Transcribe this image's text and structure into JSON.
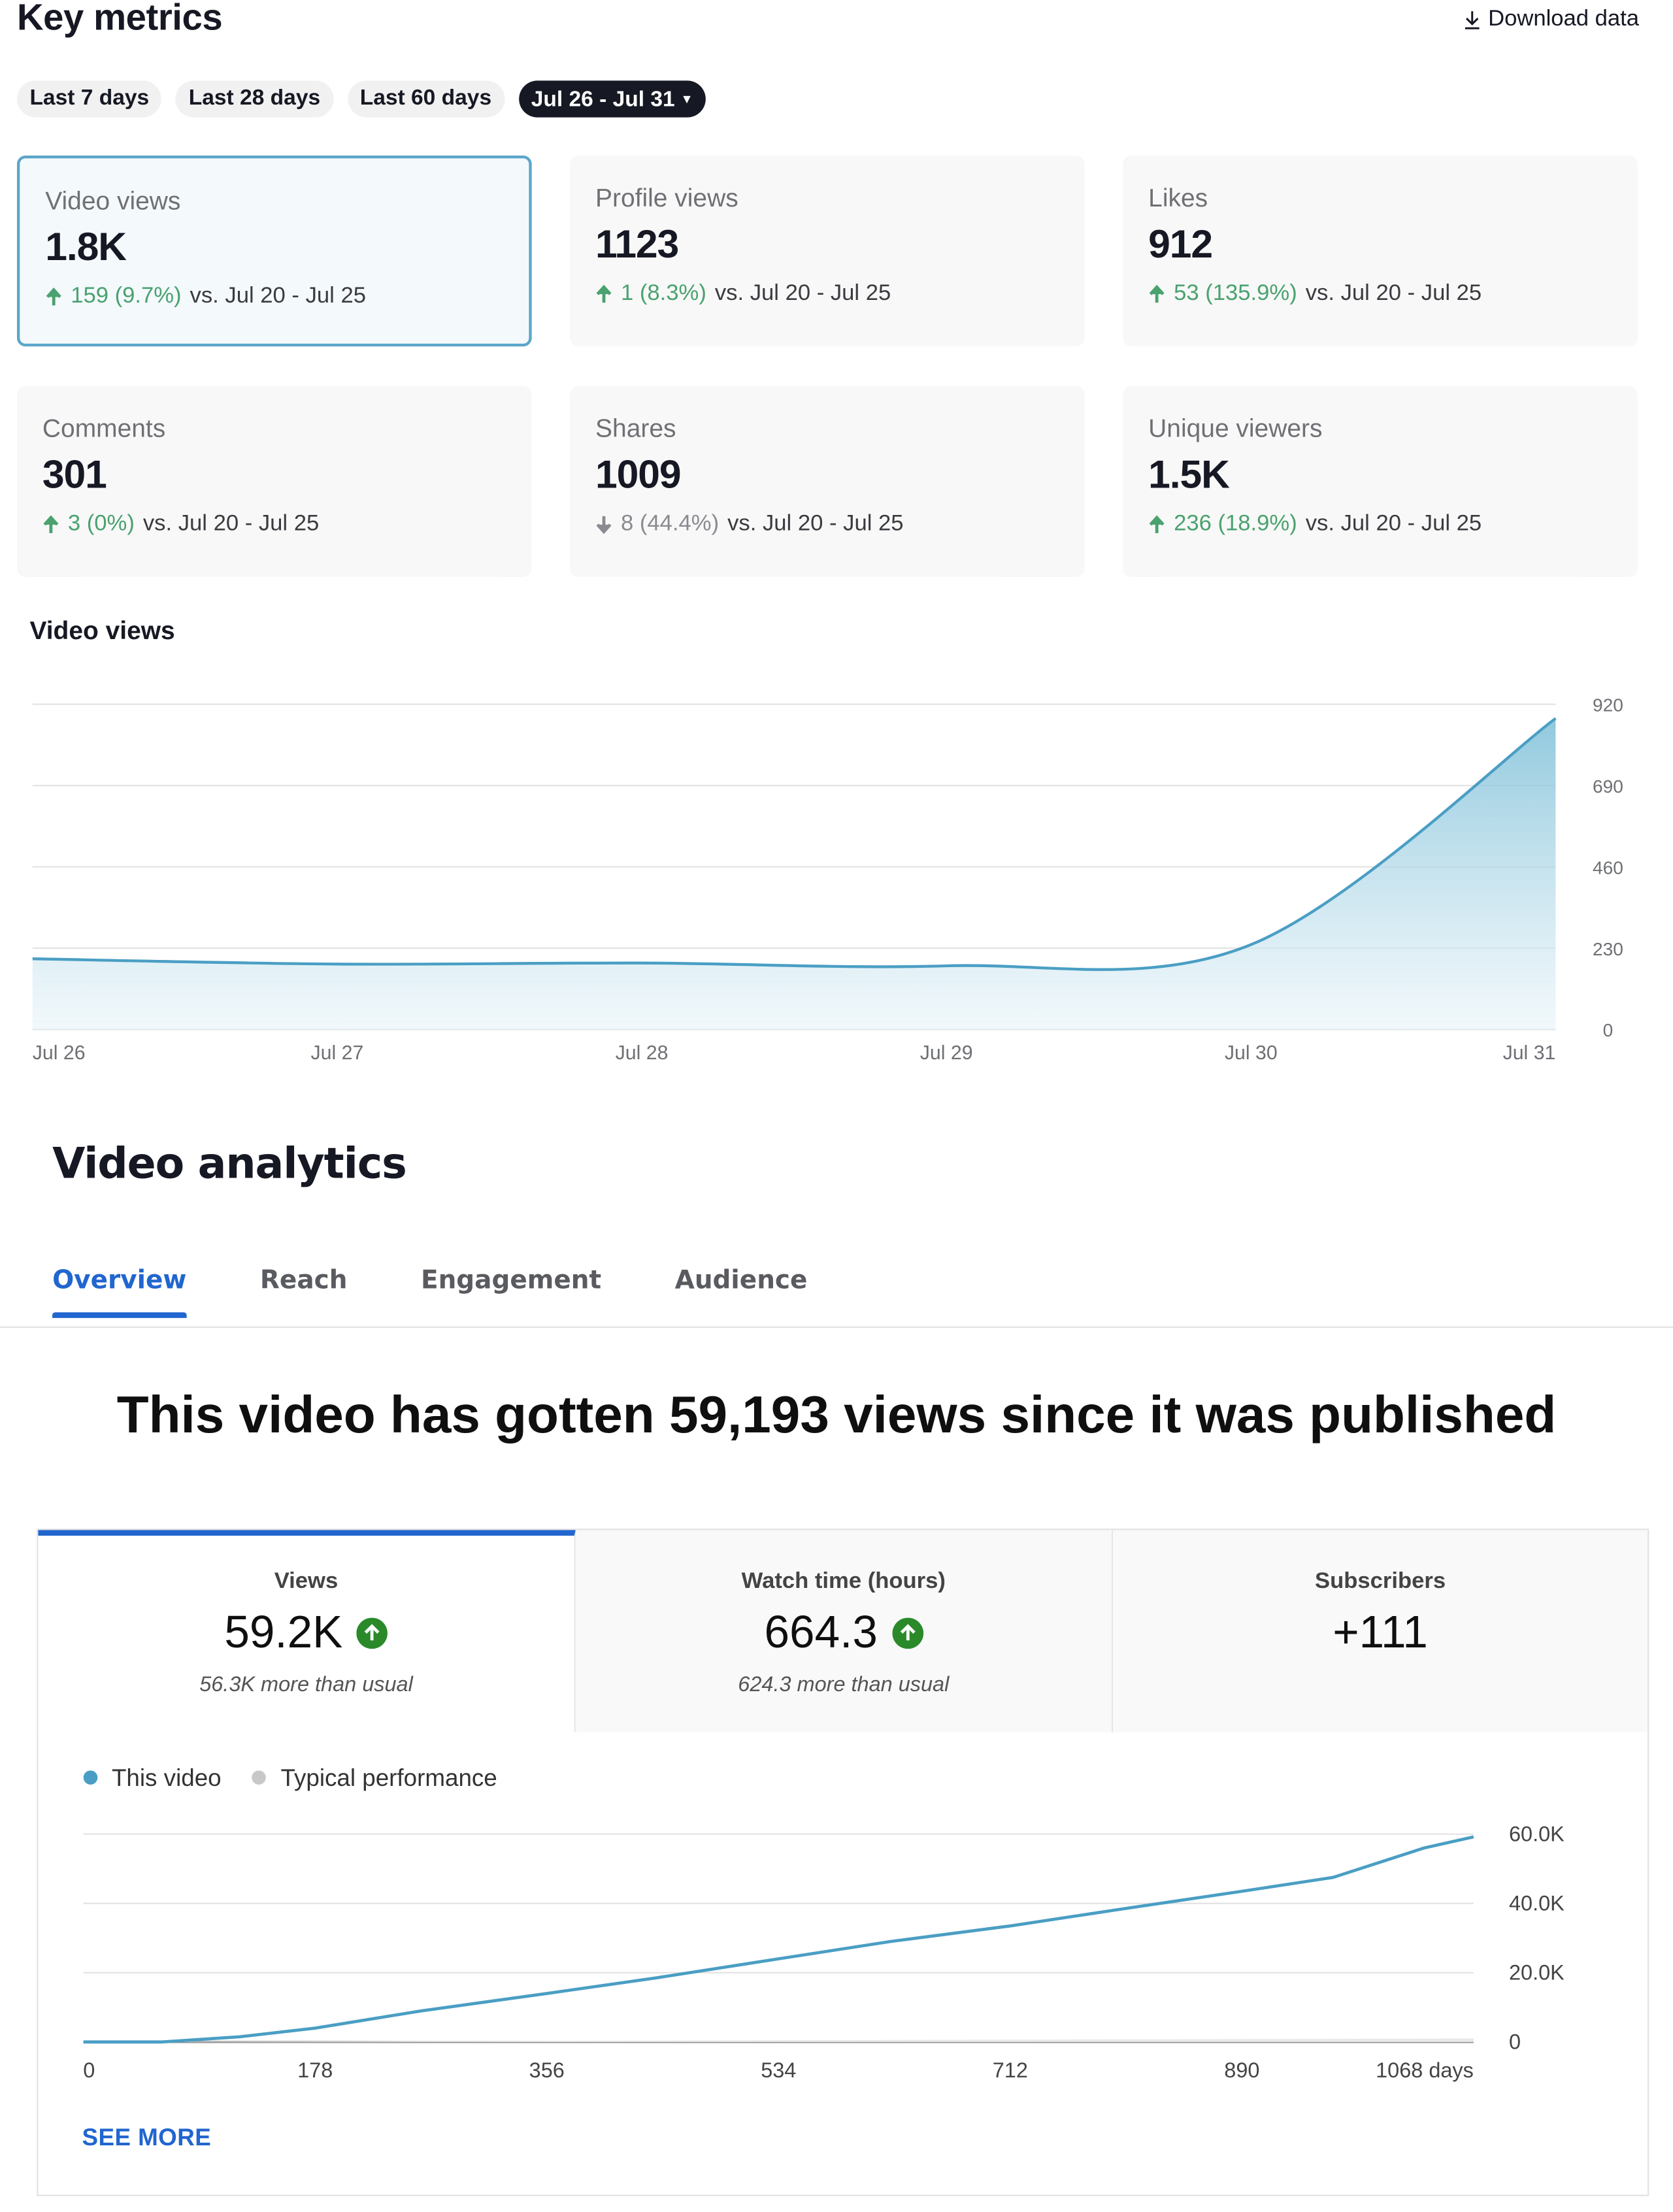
{
  "key_metrics": {
    "title": "Key metrics",
    "download_label": "Download data",
    "ranges": [
      "Last 7 days",
      "Last 28 days",
      "Last 60 days"
    ],
    "active_range": "Jul 26 - Jul 31",
    "cards": [
      {
        "label": "Video views",
        "value": "1.8K",
        "dir": "up",
        "change": "159 (9.7%)",
        "compare": "vs.  Jul 20 - Jul 25"
      },
      {
        "label": "Profile views",
        "value": "1123",
        "dir": "up",
        "change": "1 (8.3%)",
        "compare": "vs.  Jul 20 - Jul 25"
      },
      {
        "label": "Likes",
        "value": "912",
        "dir": "up",
        "change": "53 (135.9%)",
        "compare": "vs.  Jul 20 - Jul 25"
      },
      {
        "label": "Comments",
        "value": "301",
        "dir": "up",
        "change": "3 (0%)",
        "compare": "vs.  Jul 20 - Jul 25"
      },
      {
        "label": "Shares",
        "value": "1009",
        "dir": "down",
        "change": "8 (44.4%)",
        "compare": "vs.  Jul 20 - Jul 25"
      },
      {
        "label": "Unique viewers",
        "value": "1.5K",
        "dir": "up",
        "change": "236 (18.9%)",
        "compare": "vs.  Jul 20 - Jul 25"
      }
    ],
    "chart_title": "Video views"
  },
  "analytics": {
    "title": "Video analytics",
    "tabs": [
      "Overview",
      "Reach",
      "Engagement",
      "Audience"
    ],
    "active_tab": "Overview",
    "headline": "This video has gotten 59,193 views since it was published",
    "metrics": [
      {
        "name": "Views",
        "value": "59.2K",
        "up": true,
        "note": "56.3K more than usual"
      },
      {
        "name": "Watch time (hours)",
        "value": "664.3",
        "up": true,
        "note": "624.3 more than usual"
      },
      {
        "name": "Subscribers",
        "value": "+111",
        "up": false,
        "note": ""
      }
    ],
    "legend": [
      "This video",
      "Typical performance"
    ],
    "see_more": "SEE MORE"
  },
  "colors": {
    "accent_blue": "#2166cf",
    "line_blue": "#4a9ec4",
    "up_green": "#4aa26f",
    "yt_green": "#2a8a2a"
  },
  "chart_data": [
    {
      "type": "area",
      "title": "Video views",
      "categories": [
        "Jul 26",
        "Jul 27",
        "Jul 28",
        "Jul 29",
        "Jul 30",
        "Jul 31"
      ],
      "values": [
        200,
        185,
        188,
        180,
        240,
        880
      ],
      "yticks": [
        0,
        230,
        460,
        690,
        920
      ],
      "ylim": [
        0,
        920
      ],
      "grid": true
    },
    {
      "type": "line",
      "series": [
        {
          "name": "This video",
          "x": [
            0,
            60,
            120,
            178,
            260,
            356,
            440,
            534,
            620,
            712,
            800,
            890,
            960,
            1030,
            1068
          ],
          "values": [
            0,
            0,
            1500,
            4000,
            9000,
            14000,
            18500,
            24000,
            29000,
            33500,
            38500,
            43500,
            47500,
            56000,
            59200
          ]
        },
        {
          "name": "Typical performance",
          "x": [
            0,
            1068
          ],
          "values": [
            0,
            1000
          ]
        }
      ],
      "xticks": [
        "0",
        "178",
        "356",
        "534",
        "712",
        "890",
        "1068 days"
      ],
      "yticks": [
        "0",
        "20.0K",
        "40.0K",
        "60.0K"
      ],
      "ylim": [
        0,
        60000
      ],
      "grid": true
    }
  ]
}
